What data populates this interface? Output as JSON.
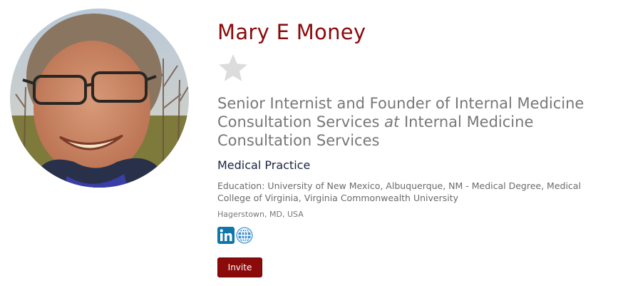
{
  "profile": {
    "name": "Mary E Money",
    "photo_alt": "Profile photo of Mary E Money",
    "rating_icon": "star-icon",
    "headline": {
      "role": "Senior Internist and Founder of Internal Medicine Consultation Services",
      "connector": "at",
      "company": "Internal Medicine Consultation Services"
    },
    "industry": "Medical Practice",
    "education": "Education: University of New Mexico, Albuquerque, NM - Medical Degree, Medical College of Virginia, Virginia Commonwealth University",
    "location": "Hagerstown, MD, USA",
    "socials": [
      {
        "icon": "linkedin-icon"
      },
      {
        "icon": "globe-icon"
      }
    ],
    "invite_label": "Invite"
  },
  "colors": {
    "brand": "#8b0a0a",
    "headline": "#777777",
    "industry": "#1a2340",
    "social_blue": "#0e76a8",
    "globe_blue": "#3a8fd0",
    "star": "#dcdcdc"
  }
}
